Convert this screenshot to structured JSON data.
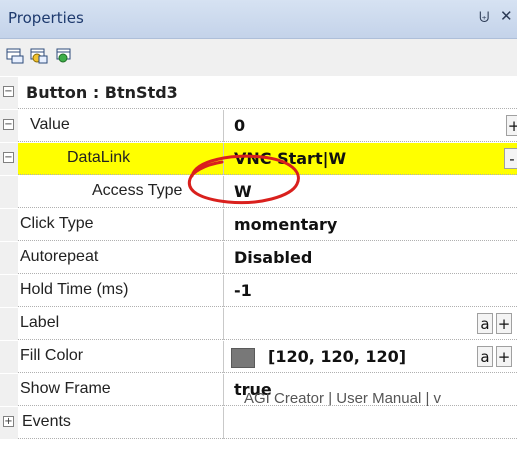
{
  "panel": {
    "title": "Properties",
    "pin_icon": "pin-icon",
    "close_icon": "close-icon",
    "toolbar_icons": [
      "categorized-view-icon",
      "alphabetical-view-icon",
      "property-pages-icon"
    ]
  },
  "grid": {
    "category": {
      "label": "Button : BtnStd3",
      "expander": "−"
    },
    "rows": [
      {
        "name": "Value",
        "value": "0",
        "expander": "−",
        "button": "+"
      },
      {
        "name": "DataLink",
        "value": "VNC Start|W",
        "expander": "−",
        "button": "-",
        "highlight": "#ffff00"
      },
      {
        "name": "Access Type",
        "value": "W"
      },
      {
        "name": "Click Type",
        "value": "momentary"
      },
      {
        "name": "Autorepeat",
        "value": "Disabled"
      },
      {
        "name": "Hold Time (ms)",
        "value": "-1"
      },
      {
        "name": "Label",
        "value": "",
        "buttons": [
          "a",
          "+"
        ]
      },
      {
        "name": "Fill Color",
        "value": "[120, 120, 120]",
        "swatch": "#787878",
        "buttons": [
          "a",
          "+"
        ]
      },
      {
        "name": "Show Frame",
        "value": "true"
      },
      {
        "name": "Events",
        "value": "",
        "expander": "+"
      }
    ]
  },
  "watermark": "AGI Creator | User Manual | v",
  "annotation_color": "#d9201d"
}
